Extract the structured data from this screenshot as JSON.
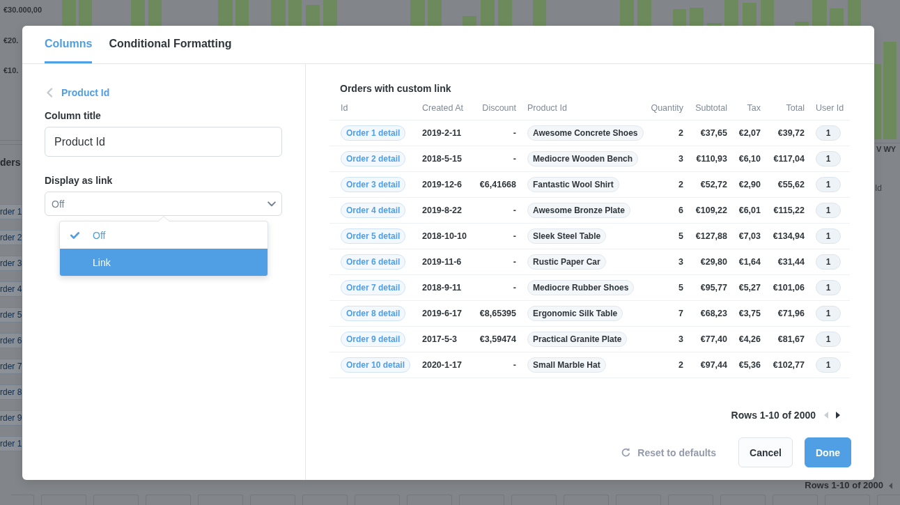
{
  "background": {
    "chart": {
      "axis_labels": [
        "€30.000,00",
        "€20.",
        "€10."
      ],
      "category_label": "V WY"
    },
    "table": {
      "title": "ders",
      "header": "Id",
      "links": [
        "rder 1",
        "rder 2",
        "rder 3",
        "rder 4",
        "rder 5",
        "rder 6",
        "rder 7",
        "rder 8",
        "rder 9",
        "rder 1"
      ],
      "pagination": "Rows 1-10 of 2000"
    }
  },
  "dialog": {
    "tabs": [
      {
        "label": "Columns",
        "selected": true
      },
      {
        "label": "Conditional Formatting",
        "selected": false
      }
    ],
    "settings": {
      "back_link": "Product Id",
      "fields": [
        {
          "kind": "text",
          "label": "Column title",
          "value": "Product Id"
        },
        {
          "kind": "select",
          "label": "Display as link",
          "value": "Off",
          "expanded": true,
          "options": [
            {
              "label": "Off",
              "selected": true,
              "hovered": false
            },
            {
              "label": "Link",
              "selected": false,
              "hovered": true
            }
          ]
        }
      ]
    },
    "preview": {
      "title": "Orders with custom link",
      "columns": [
        {
          "label": "Id",
          "kind": "link"
        },
        {
          "label": "Created At",
          "kind": "text"
        },
        {
          "label": "Discount",
          "kind": "number"
        },
        {
          "label": "Product Id",
          "kind": "tag"
        },
        {
          "label": "Quantity",
          "kind": "number"
        },
        {
          "label": "Subtotal",
          "kind": "number"
        },
        {
          "label": "Tax",
          "kind": "number"
        },
        {
          "label": "Total",
          "kind": "number"
        },
        {
          "label": "User Id",
          "kind": "badge"
        }
      ],
      "rows": [
        [
          "Order 1 detail",
          "2019-2-11",
          "-",
          "Awesome Concrete Shoes",
          "2",
          "€37,65",
          "€2,07",
          "€39,72",
          "1"
        ],
        [
          "Order 2 detail",
          "2018-5-15",
          "-",
          "Mediocre Wooden Bench",
          "3",
          "€110,93",
          "€6,10",
          "€117,04",
          "1"
        ],
        [
          "Order 3 detail",
          "2019-12-6",
          "€6,41668",
          "Fantastic Wool Shirt",
          "2",
          "€52,72",
          "€2,90",
          "€55,62",
          "1"
        ],
        [
          "Order 4 detail",
          "2019-8-22",
          "-",
          "Awesome Bronze Plate",
          "6",
          "€109,22",
          "€6,01",
          "€115,22",
          "1"
        ],
        [
          "Order 5 detail",
          "2018-10-10",
          "-",
          "Sleek Steel Table",
          "5",
          "€127,88",
          "€7,03",
          "€134,94",
          "1"
        ],
        [
          "Order 6 detail",
          "2019-11-6",
          "-",
          "Rustic Paper Car",
          "3",
          "€29,80",
          "€1,64",
          "€31,44",
          "1"
        ],
        [
          "Order 7 detail",
          "2018-9-11",
          "-",
          "Mediocre Rubber Shoes",
          "5",
          "€95,77",
          "€5,27",
          "€101,06",
          "1"
        ],
        [
          "Order 8 detail",
          "2019-6-17",
          "€8,65395",
          "Ergonomic Silk Table",
          "7",
          "€68,23",
          "€3,75",
          "€71,96",
          "1"
        ],
        [
          "Order 9 detail",
          "2017-5-3",
          "€3,59474",
          "Practical Granite Plate",
          "3",
          "€77,40",
          "€4,26",
          "€81,67",
          "1"
        ],
        [
          "Order 10 detail",
          "2020-1-17",
          "-",
          "Small Marble Hat",
          "2",
          "€97,44",
          "€5,36",
          "€102,77",
          "1"
        ]
      ],
      "pagination": {
        "text": "Rows 1-10 of 2000",
        "previous_disabled": true,
        "next_disabled": false
      }
    },
    "footer": {
      "reset": "Reset to defaults",
      "buttons": [
        {
          "label": "Cancel",
          "kind": "secondary"
        },
        {
          "label": "Done",
          "kind": "primary"
        }
      ]
    }
  }
}
